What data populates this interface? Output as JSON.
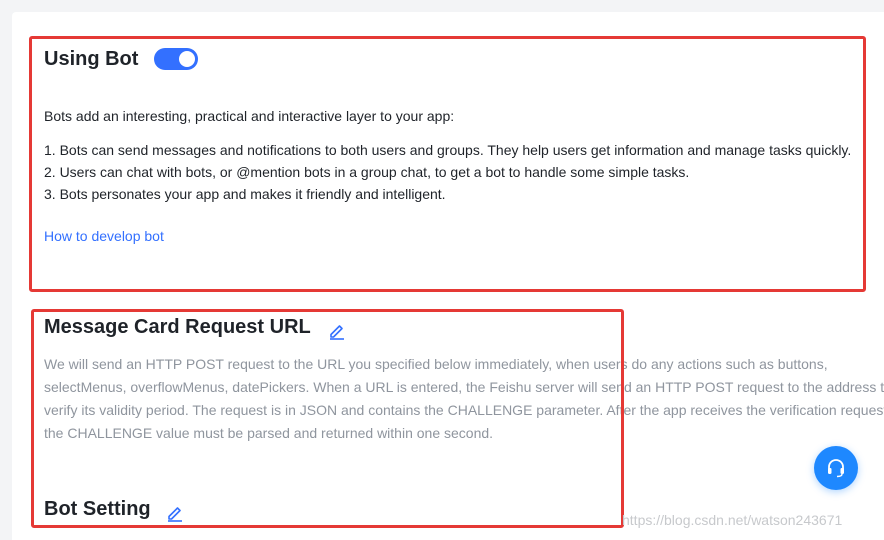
{
  "bot_section": {
    "title": "Using Bot",
    "toggle_on": true,
    "intro": "Bots add an interesting, practical and interactive layer to your app:",
    "points": [
      "1. Bots can send messages and notifications to both users and groups. They help users get information and manage tasks quickly.",
      "2. Users can chat with bots, or @mention bots in a group chat, to get a bot to handle some simple tasks.",
      "3. Bots personates your app and makes it friendly and intelligent."
    ],
    "link": "How to develop bot"
  },
  "message_card": {
    "title": "Message Card Request URL",
    "description_lines": [
      "We will send an HTTP POST request to the URL you specified below immediately, when users do any actions such as buttons,",
      "selectMenus, overflowMenus, datePickers. When a URL is entered, the Feishu server will send an HTTP POST request to the address to",
      "verify its validity period. The request is in JSON and contains the CHALLENGE parameter. After the app receives the verification request,",
      "the CHALLENGE value must be parsed and returned within one second."
    ]
  },
  "bot_setting": {
    "title": "Bot Setting"
  },
  "icons": {
    "edit": "pencil-icon",
    "support": "headset-icon"
  },
  "colors": {
    "accent": "#3370ff",
    "highlight": "#e53935",
    "fab": "#1e88ff"
  },
  "watermark": "https://blog.csdn.net/watson243671"
}
